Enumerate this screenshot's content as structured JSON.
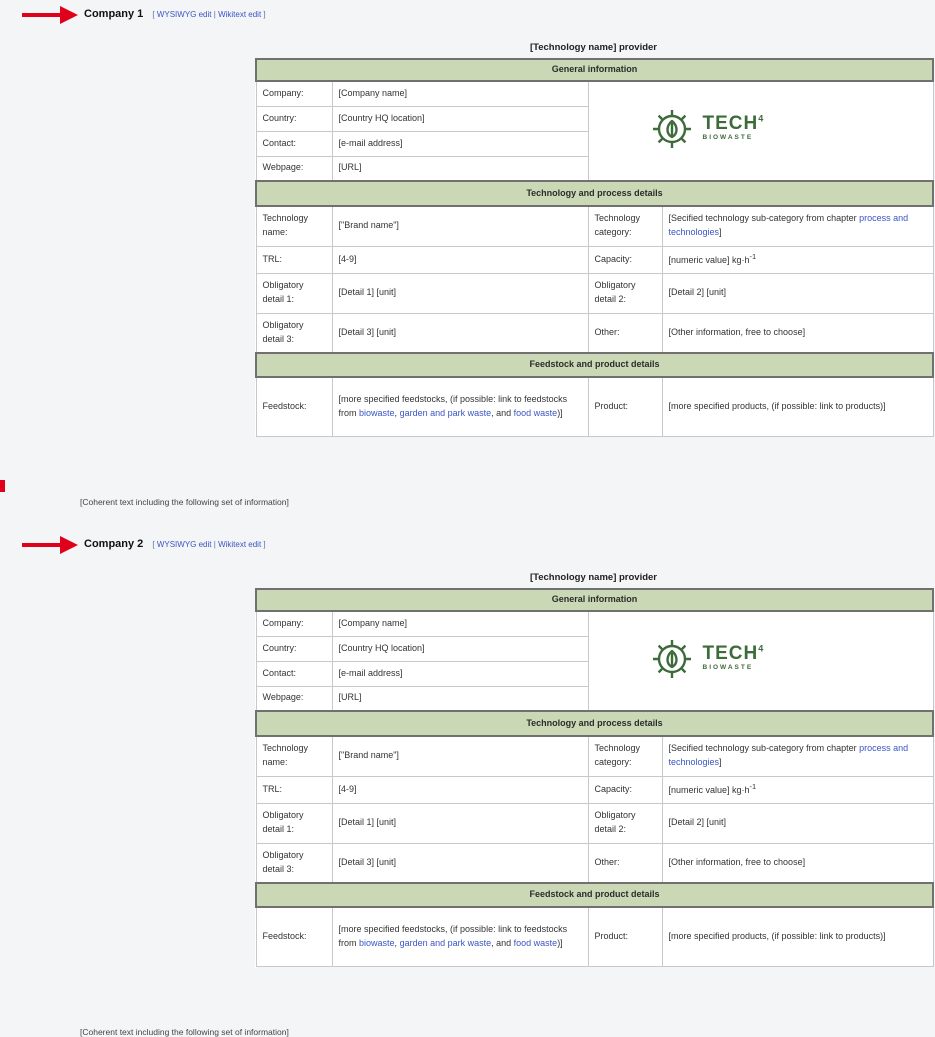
{
  "sections": [
    {
      "heading": "Company 1",
      "edit_open": "[",
      "edit_wysiwyg": "WYSIWYG edit",
      "edit_sep": "|",
      "edit_wikitext": "Wikitext edit",
      "edit_close": "]",
      "caption": "[Technology name] provider",
      "general_header": "General information",
      "company_label": "Company:",
      "company_value": "[Company name]",
      "country_label": "Country:",
      "country_value": "[Country HQ location]",
      "contact_label": "Contact:",
      "contact_value": "[e-mail address]",
      "webpage_label": "Webpage:",
      "webpage_value": "[URL]",
      "logo_text": "TECH",
      "logo_sup": "4",
      "logo_sub": "BIOWASTE",
      "tech_header": "Technology and process details",
      "techname_label": "Technology name:",
      "techname_value": "[\"Brand name\"]",
      "techcat_label": "Technology category:",
      "techcat_text": "[Secified technology sub-category from chapter ",
      "techcat_link": "process and technologies",
      "techcat_end": "]",
      "trl_label": "TRL:",
      "trl_value": "[4-9]",
      "capacity_label": "Capacity:",
      "capacity_value": "[numeric value] kg·h",
      "capacity_sup": "-1",
      "od1_label": "Obligatory detail 1:",
      "od1_value": "[Detail 1] [unit]",
      "od2_label": "Obligatory detail 2:",
      "od2_value": "[Detail 2] [unit]",
      "od3_label": "Obligatory detail 3:",
      "od3_value": "[Detail 3] [unit]",
      "other_label": "Other:",
      "other_value": "[Other information, free to choose]",
      "feed_header": "Feedstock and product details",
      "feedstock_label": "Feedstock:",
      "feedstock_text": "[more specified feedstocks, (if possible: link to feedstocks from ",
      "feedstock_link1": "biowaste",
      "feedstock_sep1": ", ",
      "feedstock_link2": "garden and park waste",
      "feedstock_sep2": ", and ",
      "feedstock_link3": "food waste",
      "feedstock_end": ")]",
      "product_label": "Product:",
      "product_value": "[more specified products, (if possible: link to products)]",
      "coherent": "[Coherent text including the following set of information]"
    },
    {
      "heading": "Company 2",
      "edit_open": "[",
      "edit_wysiwyg": "WYSIWYG edit",
      "edit_sep": "|",
      "edit_wikitext": "Wikitext edit",
      "edit_close": "]",
      "caption": "[Technology name] provider",
      "general_header": "General information",
      "company_label": "Company:",
      "company_value": "[Company name]",
      "country_label": "Country:",
      "country_value": "[Country HQ location]",
      "contact_label": "Contact:",
      "contact_value": "[e-mail address]",
      "webpage_label": "Webpage:",
      "webpage_value": "[URL]",
      "logo_text": "TECH",
      "logo_sup": "4",
      "logo_sub": "BIOWASTE",
      "tech_header": "Technology and process details",
      "techname_label": "Technology name:",
      "techname_value": "[\"Brand name\"]",
      "techcat_label": "Technology category:",
      "techcat_text": "[Secified technology sub-category from chapter ",
      "techcat_link": "process and technologies",
      "techcat_end": "]",
      "trl_label": "TRL:",
      "trl_value": "[4-9]",
      "capacity_label": "Capacity:",
      "capacity_value": "[numeric value] kg·h",
      "capacity_sup": "-1",
      "od1_label": "Obligatory detail 1:",
      "od1_value": "[Detail 1] [unit]",
      "od2_label": "Obligatory detail 2:",
      "od2_value": "[Detail 2] [unit]",
      "od3_label": "Obligatory detail 3:",
      "od3_value": "[Detail 3] [unit]",
      "other_label": "Other:",
      "other_value": "[Other information, free to choose]",
      "feed_header": "Feedstock and product details",
      "feedstock_label": "Feedstock:",
      "feedstock_text": "[more specified feedstocks, (if possible: link to feedstocks from ",
      "feedstock_link1": "biowaste",
      "feedstock_sep1": ", ",
      "feedstock_link2": "garden and park waste",
      "feedstock_sep2": ", and ",
      "feedstock_link3": "food waste",
      "feedstock_end": ")]",
      "product_label": "Product:",
      "product_value": "[more specified products, (if possible: link to products)]",
      "coherent": "[Coherent text including the following set of information]"
    }
  ],
  "colors": {
    "arrow": "#e0001b",
    "section_header_bg": "#cad8b5",
    "link": "#3a55c5",
    "logo": "#3d6b3a"
  },
  "icons": [
    "red-arrow-icon",
    "tech4biowaste-logo-icon"
  ]
}
